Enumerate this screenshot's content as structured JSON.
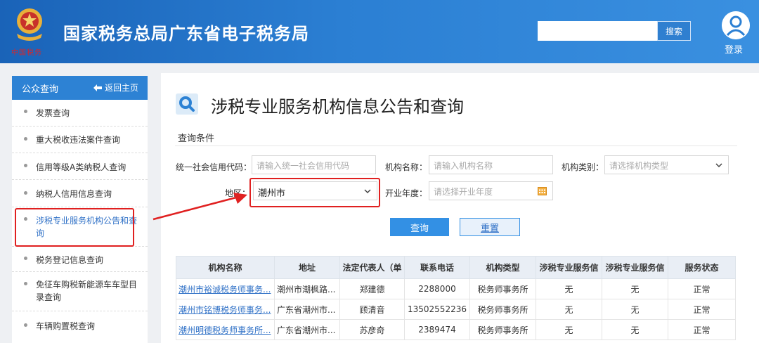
{
  "header": {
    "site_title": "国家税务总局广东省电子税务局",
    "emblem_caption": "中国税务",
    "search_value": "",
    "search_button": "搜索",
    "login_label": "登录"
  },
  "sidebar": {
    "title": "公众查询",
    "back_label": "返回主页",
    "items": [
      {
        "label": "发票查询"
      },
      {
        "label": "重大税收违法案件查询"
      },
      {
        "label": "信用等级A类纳税人查询"
      },
      {
        "label": "纳税人信用信息查询"
      },
      {
        "label": "涉税专业服务机构公告和查询"
      },
      {
        "label": "税务登记信息查询"
      },
      {
        "label": "免征车购税新能源车车型目录查询"
      },
      {
        "label": "车辆购置税查询"
      }
    ]
  },
  "main": {
    "page_title": "涉税专业服务机构信息公告和查询",
    "section_label": "查询条件",
    "filters": {
      "credit_code_label": "统一社会信用代码：",
      "credit_code_placeholder": "请输入统一社会信用代码",
      "org_name_label": "机构名称：",
      "org_name_placeholder": "请输入机构名称",
      "org_type_label": "机构类别：",
      "org_type_placeholder": "请选择机构类型",
      "region_label": "地区：",
      "region_value": "潮州市",
      "year_label": "开业年度：",
      "year_placeholder": "请选择开业年度"
    },
    "query_button": "查询",
    "reset_button": "重置",
    "table": {
      "headers": [
        "机构名称",
        "地址",
        "法定代表人（单",
        "联系电话",
        "机构类型",
        "涉税专业服务信",
        "涉税专业服务信",
        "服务状态"
      ],
      "rows": [
        [
          "潮州市裕诚税务师事务...",
          "潮州市潮枫路...",
          "郑建德",
          "2288000",
          "税务师事务所",
          "无",
          "无",
          "正常"
        ],
        [
          "潮州市铭博税务师事务...",
          "广东省潮州市...",
          "顾清音",
          "13502552236",
          "税务师事务所",
          "无",
          "无",
          "正常"
        ],
        [
          "潮州明德税务师事务所...",
          "广东省潮州市...",
          "苏彦奇",
          "2389474",
          "税务师事务所",
          "无",
          "无",
          "正常"
        ]
      ]
    }
  },
  "colors": {
    "header_blue": "#2b7fd3",
    "accent_blue": "#3390e4",
    "highlight_red": "#e02020",
    "link_blue": "#2d6fc6"
  }
}
